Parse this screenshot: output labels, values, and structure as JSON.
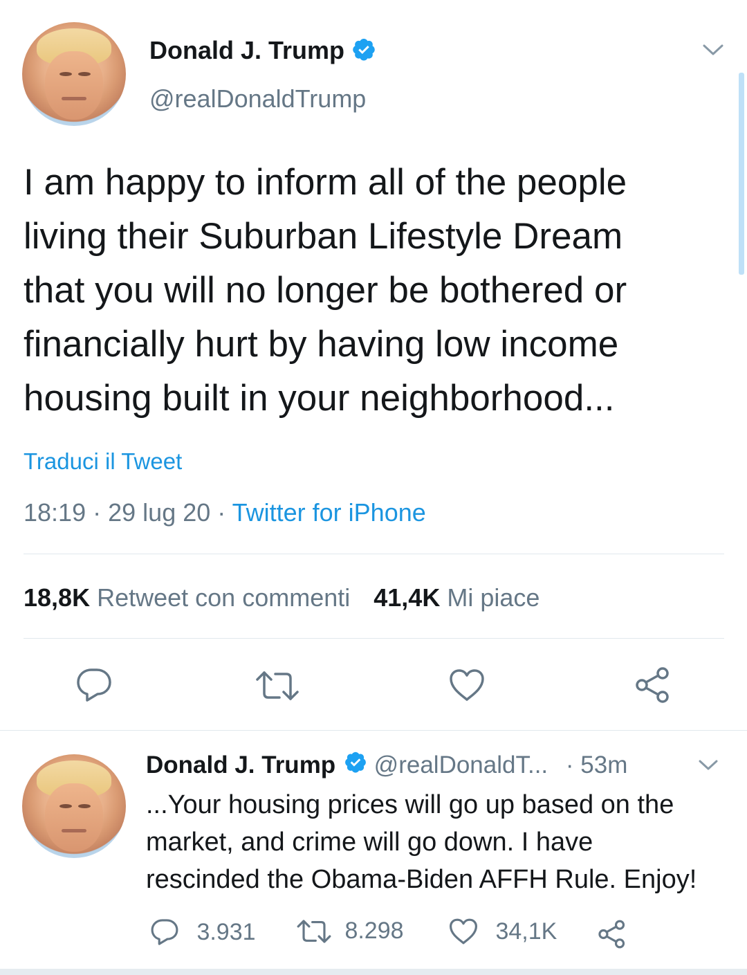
{
  "main_tweet": {
    "display_name": "Donald J. Trump",
    "handle": "@realDonaldTrump",
    "lines": [
      "I am happy to inform all of the people",
      "living their Suburban Lifestyle Dream",
      "that you will no longer be bothered or",
      "financially hurt by having low income",
      "housing built in your neighborhood..."
    ],
    "translate_label": "Traduci il Tweet",
    "time": "18:19",
    "date": "29 lug 20",
    "separator": "·",
    "source": "Twitter for iPhone",
    "retweets_count": "18,8K",
    "retweets_label": "Retweet con commenti",
    "likes_count": "41,4K",
    "likes_label": "Mi piace",
    "icons": [
      "reply-icon",
      "retweet-icon",
      "like-icon",
      "share-icon",
      "chevron-down-icon",
      "verified-icon"
    ]
  },
  "reply_tweet": {
    "display_name": "Donald J. Trump",
    "handle": "@realDonaldT...",
    "age": "· 53m",
    "lines": [
      "...Your housing prices will go up based on the",
      "market, and crime will go down. I have",
      "rescinded the Obama-Biden AFFH Rule. Enjoy!"
    ],
    "reply_count": "3.931",
    "retweet_count": "8.298",
    "like_count": "34,1K"
  },
  "colors": {
    "accent": "#1da1f2",
    "link": "#1b95e0",
    "muted": "#657786",
    "text": "#14171a",
    "divider": "#e1e8ed",
    "scrollbar": "#9fd0f4"
  }
}
